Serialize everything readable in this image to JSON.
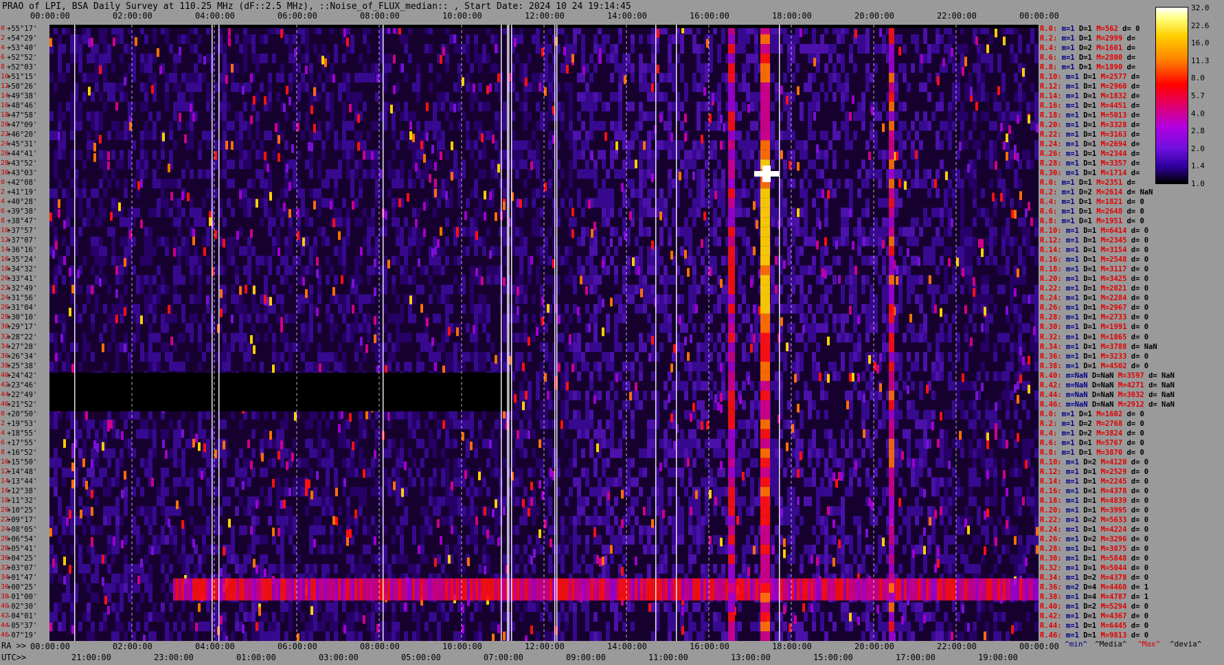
{
  "header": {
    "title": "PRAO of LPI, BSA Daily Survey at 110.25 MHz (dF::2.5 MHz), ::Noise_of_FLUX_median:: , Start Date: 2024 10 24 19:14:45"
  },
  "footer": {
    "ra_prefix": "RA >>",
    "utc_prefix": "UTC>>"
  },
  "chart_data": {
    "type": "heatmap",
    "title": "PRAO of LPI, BSA Daily Survey at 110.25 MHz (dF::2.5 MHz), ::Noise_of_FLUX_median:: , Start Date: 2024 10 24 19:14:45",
    "x_top_ticks": [
      "00:00:00",
      "02:00:00",
      "04:00:00",
      "06:00:00",
      "08:00:00",
      "10:00:00",
      "12:00:00",
      "14:00:00",
      "16:00:00",
      "18:00:00",
      "20:00:00",
      "22:00:00",
      "00:00:00"
    ],
    "x_ra_ticks": [
      "00:00:00",
      "02:00:00",
      "04:00:00",
      "06:00:00",
      "08:00:00",
      "10:00:00",
      "12:00:00",
      "14:00:00",
      "16:00:00",
      "18:00:00",
      "20:00:00",
      "22:00:00",
      "00:00:00"
    ],
    "x_utc_ticks": [
      "21:00:00",
      "23:00:00",
      "01:00:00",
      "03:00:00",
      "05:00:00",
      "07:00:00",
      "09:00:00",
      "11:00:00",
      "13:00:00",
      "15:00:00",
      "17:00:00",
      "19:00:00"
    ],
    "declinations": [
      "+55°17'",
      "+54°29'",
      "+53°40'",
      "+52°52'",
      "+52°03'",
      "+51°15'",
      "+50°26'",
      "+49°38'",
      "+48°46'",
      "+47°58'",
      "+47°09'",
      "+46°20'",
      "+45°31'",
      "+44°41'",
      "+43°52'",
      "+43°03'",
      "+42°08'",
      "+41°19'",
      "+40°28'",
      "+39°38'",
      "+38°47'",
      "+37°57'",
      "+37°07'",
      "+36°16'",
      "+35°24'",
      "+34°32'",
      "+33°41'",
      "+32°49'",
      "+31°56'",
      "+31°04'",
      "+30°10'",
      "+29°17'",
      "+28°22'",
      "+27°28'",
      "+26°34'",
      "+25°38'",
      "+24°42'",
      "+23°46'",
      "+22°49'",
      "+21°52'",
      "+20°50'",
      "+19°53'",
      "+18°55'",
      "+17°55'",
      "+16°52'",
      "+15°50'",
      "+14°48'",
      "+13°44'",
      "+12°38'",
      "+11°32'",
      "+10°25'",
      "+09°17'",
      "+08°05'",
      "+06°54'",
      "+05°41'",
      "+04°25'",
      "+03°07'",
      "+01°47'",
      "+00°25'",
      "-01°00'",
      "-02°30'",
      "-04°01'",
      "-05°37'",
      "-07°19'"
    ],
    "row_index": [
      "0",
      "2",
      "4",
      "6",
      "8",
      "10",
      "12",
      "14",
      "16",
      "18",
      "20",
      "22",
      "24",
      "26",
      "28",
      "30",
      "0",
      "2",
      "4",
      "6",
      "8",
      "10",
      "12",
      "14",
      "16",
      "18",
      "20",
      "22",
      "24",
      "26",
      "28",
      "30",
      "32",
      "34",
      "36",
      "38",
      "40",
      "42",
      "44",
      "46",
      "0",
      "2",
      "4",
      "6",
      "8",
      "10",
      "12",
      "14",
      "16",
      "18",
      "20",
      "22",
      "24",
      "26",
      "28",
      "30",
      "32",
      "34",
      "36",
      "38",
      "40",
      "42",
      "44",
      "46"
    ],
    "colorbar": {
      "ticks": [
        "32.0",
        "22.6",
        "16.0",
        "11.3",
        "8.0",
        "5.7",
        "4.0",
        "2.8",
        "2.0",
        "1.4",
        "1.0"
      ],
      "scale": "log"
    },
    "stats": [
      {
        "r": "R.0:",
        "m": "m=1",
        "D": "D=1",
        "M": "M=562",
        "d": "d= 0"
      },
      {
        "r": "R.2:",
        "m": "m=1",
        "D": "D=1",
        "M": "M=2999",
        "d": "d="
      },
      {
        "r": "R.4:",
        "m": "m=1",
        "D": "D=2",
        "M": "M=1601",
        "d": "d="
      },
      {
        "r": "R.6:",
        "m": "m=1",
        "D": "D=1",
        "M": "M=2800",
        "d": "d="
      },
      {
        "r": "R.8:",
        "m": "m=1",
        "D": "D=1",
        "M": "M=1890",
        "d": "d="
      },
      {
        "r": "R.10:",
        "m": "m=1",
        "D": "D=1",
        "M": "M=2577",
        "d": "d="
      },
      {
        "r": "R.12:",
        "m": "m=1",
        "D": "D=1",
        "M": "M=2960",
        "d": "d="
      },
      {
        "r": "R.14:",
        "m": "m=1",
        "D": "D=1",
        "M": "M=1832",
        "d": "d="
      },
      {
        "r": "R.16:",
        "m": "m=1",
        "D": "D=1",
        "M": "M=4451",
        "d": "d="
      },
      {
        "r": "R.18:",
        "m": "m=1",
        "D": "D=1",
        "M": "M=5013",
        "d": "d="
      },
      {
        "r": "R.20:",
        "m": "m=1",
        "D": "D=1",
        "M": "M=3328",
        "d": "d="
      },
      {
        "r": "R.22:",
        "m": "m=1",
        "D": "D=1",
        "M": "M=3163",
        "d": "d="
      },
      {
        "r": "R.24:",
        "m": "m=1",
        "D": "D=1",
        "M": "M=2694",
        "d": "d="
      },
      {
        "r": "R.26:",
        "m": "m=1",
        "D": "D=1",
        "M": "M=2344",
        "d": "d="
      },
      {
        "r": "R.28:",
        "m": "m=1",
        "D": "D=1",
        "M": "M=3357",
        "d": "d="
      },
      {
        "r": "R.30:",
        "m": "m=1",
        "D": "D=1",
        "M": "M=1714",
        "d": "d="
      },
      {
        "r": "R.0:",
        "m": "m=1",
        "D": "D=1",
        "M": "M=2351",
        "d": "d="
      },
      {
        "r": "R.2:",
        "m": "m=1",
        "D": "D=2",
        "M": "M=2614",
        "d": "d= NaN"
      },
      {
        "r": "R.4:",
        "m": "m=1",
        "D": "D=1",
        "M": "M=1821",
        "d": "d= 0"
      },
      {
        "r": "R.6:",
        "m": "m=1",
        "D": "D=1",
        "M": "M=2648",
        "d": "d= 0"
      },
      {
        "r": "R.8:",
        "m": "m=1",
        "D": "D=1",
        "M": "M=1951",
        "d": "d= 0"
      },
      {
        "r": "R.10:",
        "m": "m=1",
        "D": "D=1",
        "M": "M=6414",
        "d": "d= 0"
      },
      {
        "r": "R.12:",
        "m": "m=1",
        "D": "D=1",
        "M": "M=2345",
        "d": "d= 0"
      },
      {
        "r": "R.14:",
        "m": "m=1",
        "D": "D=1",
        "M": "M=3154",
        "d": "d= 0"
      },
      {
        "r": "R.16:",
        "m": "m=1",
        "D": "D=1",
        "M": "M=2548",
        "d": "d= 0"
      },
      {
        "r": "R.18:",
        "m": "m=1",
        "D": "D=1",
        "M": "M=3117",
        "d": "d= 0"
      },
      {
        "r": "R.20:",
        "m": "m=1",
        "D": "D=1",
        "M": "M=3425",
        "d": "d= 0"
      },
      {
        "r": "R.22:",
        "m": "m=1",
        "D": "D=1",
        "M": "M=2021",
        "d": "d= 0"
      },
      {
        "r": "R.24:",
        "m": "m=1",
        "D": "D=1",
        "M": "M=2284",
        "d": "d= 0"
      },
      {
        "r": "R.26:",
        "m": "m=1",
        "D": "D=1",
        "M": "M=2967",
        "d": "d= 0"
      },
      {
        "r": "R.28:",
        "m": "m=1",
        "D": "D=1",
        "M": "M=2733",
        "d": "d= 0"
      },
      {
        "r": "R.30:",
        "m": "m=1",
        "D": "D=1",
        "M": "M=1991",
        "d": "d= 0"
      },
      {
        "r": "R.32:",
        "m": "m=1",
        "D": "D=1",
        "M": "M=1865",
        "d": "d= 0"
      },
      {
        "r": "R.34:",
        "m": "m=1",
        "D": "D=1",
        "M": "M=3788",
        "d": "d= NaN"
      },
      {
        "r": "R.36:",
        "m": "m=1",
        "D": "D=1",
        "M": "M=3233",
        "d": "d= 0"
      },
      {
        "r": "R.38:",
        "m": "m=1",
        "D": "D=1",
        "M": "M=4502",
        "d": "d= 0"
      },
      {
        "r": "R.40:",
        "m": "m=NaN",
        "D": "D=NaN",
        "M": "M=3597",
        "d": "d= NaN"
      },
      {
        "r": "R.42:",
        "m": "m=NaN",
        "D": "D=NaN",
        "M": "M=4271",
        "d": "d= NaN"
      },
      {
        "r": "R.44:",
        "m": "m=NaN",
        "D": "D=NaN",
        "M": "M=3032",
        "d": "d= NaN"
      },
      {
        "r": "R.46:",
        "m": "m=NaN",
        "D": "D=NaN",
        "M": "M=2912",
        "d": "d= NaN"
      },
      {
        "r": "R.0:",
        "m": "m=1",
        "D": "D=1",
        "M": "M=1602",
        "d": "d= 0"
      },
      {
        "r": "R.2:",
        "m": "m=1",
        "D": "D=2",
        "M": "M=2768",
        "d": "d= 0"
      },
      {
        "r": "R.4:",
        "m": "m=1",
        "D": "D=2",
        "M": "M=3824",
        "d": "d= 0"
      },
      {
        "r": "R.6:",
        "m": "m=1",
        "D": "D=1",
        "M": "M=5767",
        "d": "d= 0"
      },
      {
        "r": "R.8:",
        "m": "m=1",
        "D": "D=1",
        "M": "M=3870",
        "d": "d= 0"
      },
      {
        "r": "R.10:",
        "m": "m=1",
        "D": "D=2",
        "M": "M=4120",
        "d": "d= 0"
      },
      {
        "r": "R.12:",
        "m": "m=1",
        "D": "D=1",
        "M": "M=2529",
        "d": "d= 0"
      },
      {
        "r": "R.14:",
        "m": "m=1",
        "D": "D=1",
        "M": "M=2245",
        "d": "d= 0"
      },
      {
        "r": "R.16:",
        "m": "m=1",
        "D": "D=1",
        "M": "M=4378",
        "d": "d= 0"
      },
      {
        "r": "R.18:",
        "m": "m=1",
        "D": "D=1",
        "M": "M=4839",
        "d": "d= 0"
      },
      {
        "r": "R.20:",
        "m": "m=1",
        "D": "D=1",
        "M": "M=3995",
        "d": "d= 0"
      },
      {
        "r": "R.22:",
        "m": "m=1",
        "D": "D=2",
        "M": "M=5633",
        "d": "d= 0"
      },
      {
        "r": "R.24:",
        "m": "m=1",
        "D": "D=1",
        "M": "M=4224",
        "d": "d= 0"
      },
      {
        "r": "R.26:",
        "m": "m=1",
        "D": "D=2",
        "M": "M=3296",
        "d": "d= 0"
      },
      {
        "r": "R.28:",
        "m": "m=1",
        "D": "D=1",
        "M": "M=3875",
        "d": "d= 0"
      },
      {
        "r": "R.30:",
        "m": "m=1",
        "D": "D=1",
        "M": "M=5848",
        "d": "d= 0"
      },
      {
        "r": "R.32:",
        "m": "m=1",
        "D": "D=1",
        "M": "M=5044",
        "d": "d= 0"
      },
      {
        "r": "R.34:",
        "m": "m=1",
        "D": "D=2",
        "M": "M=4378",
        "d": "d= 0"
      },
      {
        "r": "R.36:",
        "m": "m=2",
        "D": "D=4",
        "M": "M=4460",
        "d": "d= 1"
      },
      {
        "r": "R.38:",
        "m": "m=1",
        "D": "D=4",
        "M": "M=4787",
        "d": "d= 1"
      },
      {
        "r": "R.40:",
        "m": "m=1",
        "D": "D=2",
        "M": "M=5294",
        "d": "d= 0"
      },
      {
        "r": "R.42:",
        "m": "m=1",
        "D": "D=1",
        "M": "M=4367",
        "d": "d= 0"
      },
      {
        "r": "R.44:",
        "m": "m=1",
        "D": "D=1",
        "M": "M=6445",
        "d": "d= 0"
      },
      {
        "r": "R.46:",
        "m": "m=1",
        "D": "D=1",
        "M": "M=9813",
        "d": "d= 0"
      }
    ],
    "legend": {
      "min": "^min^",
      "median": "^Media^",
      "max": "^Max^",
      "devia": "^devia^"
    },
    "colors": {
      "min": "#00008a",
      "median": "#000000",
      "max": "#e00000",
      "devia": "#000000"
    }
  }
}
